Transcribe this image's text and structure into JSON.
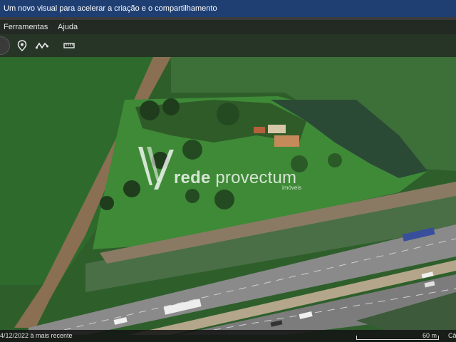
{
  "banner": {
    "text": "Um novo visual para acelerar a criação e o compartilhamento"
  },
  "menu": {
    "items": [
      "Ferramentas",
      "Ajuda"
    ]
  },
  "toolbar": {
    "icons": [
      "circle-button",
      "pin-icon",
      "path-icon",
      "ruler-icon"
    ]
  },
  "watermark": {
    "brand_first": "rede",
    "brand_second": "provectum",
    "subtitle": "imóveis"
  },
  "status": {
    "date": "4/12/2022 à mais recente",
    "scale": "60 m",
    "coords": "Câ"
  },
  "colors": {
    "banner": "#1f3f73",
    "field": "#2f5a2a",
    "highway": "#7f7f7f"
  }
}
